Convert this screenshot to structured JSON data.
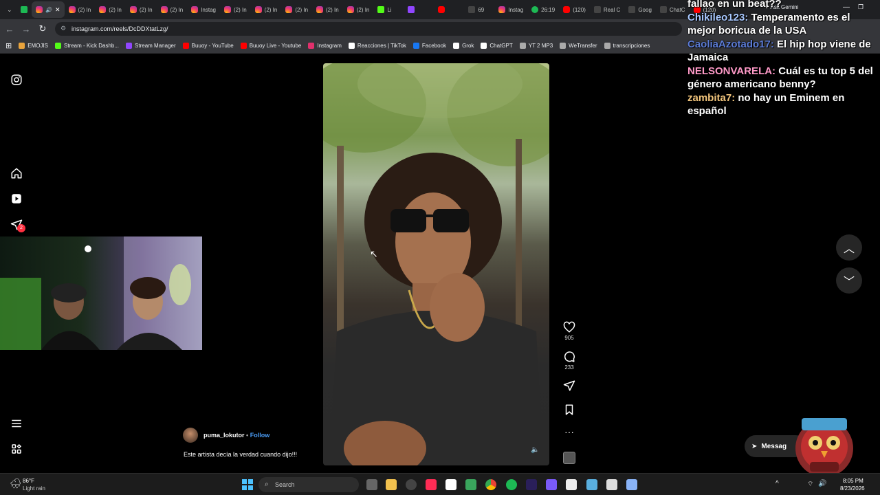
{
  "browser": {
    "tabs": [
      {
        "label": "(2) In",
        "icon": "fav-ig"
      },
      {
        "label": "(2) In",
        "icon": "fav-ig"
      },
      {
        "label": "(2) In",
        "icon": "fav-ig"
      },
      {
        "label": "(2) In",
        "icon": "fav-ig"
      },
      {
        "label": "Instag",
        "icon": "fav-ig"
      },
      {
        "label": "(2) In",
        "icon": "fav-ig"
      },
      {
        "label": "(2) In",
        "icon": "fav-ig"
      },
      {
        "label": "(2) In",
        "icon": "fav-ig"
      },
      {
        "label": "(2) In",
        "icon": "fav-ig"
      },
      {
        "label": "(2) In",
        "icon": "fav-ig"
      },
      {
        "label": "Li",
        "icon": "fav-kick"
      },
      {
        "label": "",
        "icon": "fav-tw"
      },
      {
        "label": "",
        "icon": "fav-yt"
      },
      {
        "label": "69",
        "icon": "fav-dark"
      },
      {
        "label": "Instag",
        "icon": "fav-ig"
      },
      {
        "label": "26:19",
        "icon": "fav-green"
      },
      {
        "label": "(120)",
        "icon": "fav-yt"
      },
      {
        "label": "Real C",
        "icon": "fav-dark"
      },
      {
        "label": "Goog",
        "icon": "fav-dark"
      },
      {
        "label": "ChatC",
        "icon": "fav-dark"
      },
      {
        "label": "(120)",
        "icon": "fav-yt"
      }
    ],
    "ask_gemini": "Ask Gemini",
    "url": "instagram.com/reels/DcDDXtatLzg/",
    "bookmarks": [
      {
        "label": "EMOJIS",
        "color": "#e8a33c"
      },
      {
        "label": "Stream - Kick Dashb...",
        "color": "#53fc18"
      },
      {
        "label": "Stream Manager",
        "color": "#9146ff"
      },
      {
        "label": "Buuoy - YouTube",
        "color": "#ff0000"
      },
      {
        "label": "Buuoy Live - Youtube",
        "color": "#ff0000"
      },
      {
        "label": "Instagram",
        "color": "#e1306c"
      },
      {
        "label": "Reacciones | TikTok",
        "color": "#ffffff"
      },
      {
        "label": "Facebook",
        "color": "#1877f2"
      },
      {
        "label": "Grok",
        "color": "#ffffff"
      },
      {
        "label": "ChatGPT",
        "color": "#ffffff"
      },
      {
        "label": "YT 2 MP3",
        "color": "#aaaaaa"
      },
      {
        "label": "WeTransfer",
        "color": "#aaaaaa"
      },
      {
        "label": "transcripciones",
        "color": "#aaaaaa"
      }
    ]
  },
  "reel": {
    "likes": "905",
    "comments": "233",
    "username": "puma_lokutor",
    "follow": "Follow",
    "separator": "•",
    "caption": "Este artista decía la verdad cuando dijo!!!",
    "direct_badge": "2"
  },
  "messages_button": "Messag",
  "chat": [
    {
      "user": "",
      "text": "fallao en un beat??"
    },
    {
      "user": "Chikileo123:",
      "text": "Temperamento es el mejor boricua de la USA",
      "cls": "u1"
    },
    {
      "user": "CaoliaAzotado17:",
      "text": "El hip hop viene de Jamaica",
      "cls": "u2"
    },
    {
      "user": "NELSONVARELA:",
      "text": "Cuál es tu top 5 del género americano benny?",
      "cls": "u3"
    },
    {
      "user": "zambita7:",
      "text": "no hay un Eminem en español",
      "cls": "u4"
    }
  ],
  "taskbar": {
    "weather_temp": "86°F",
    "weather_desc": "Light rain",
    "search_placeholder": "Search",
    "time": "8:05 PM",
    "date": "8/23/2026"
  }
}
